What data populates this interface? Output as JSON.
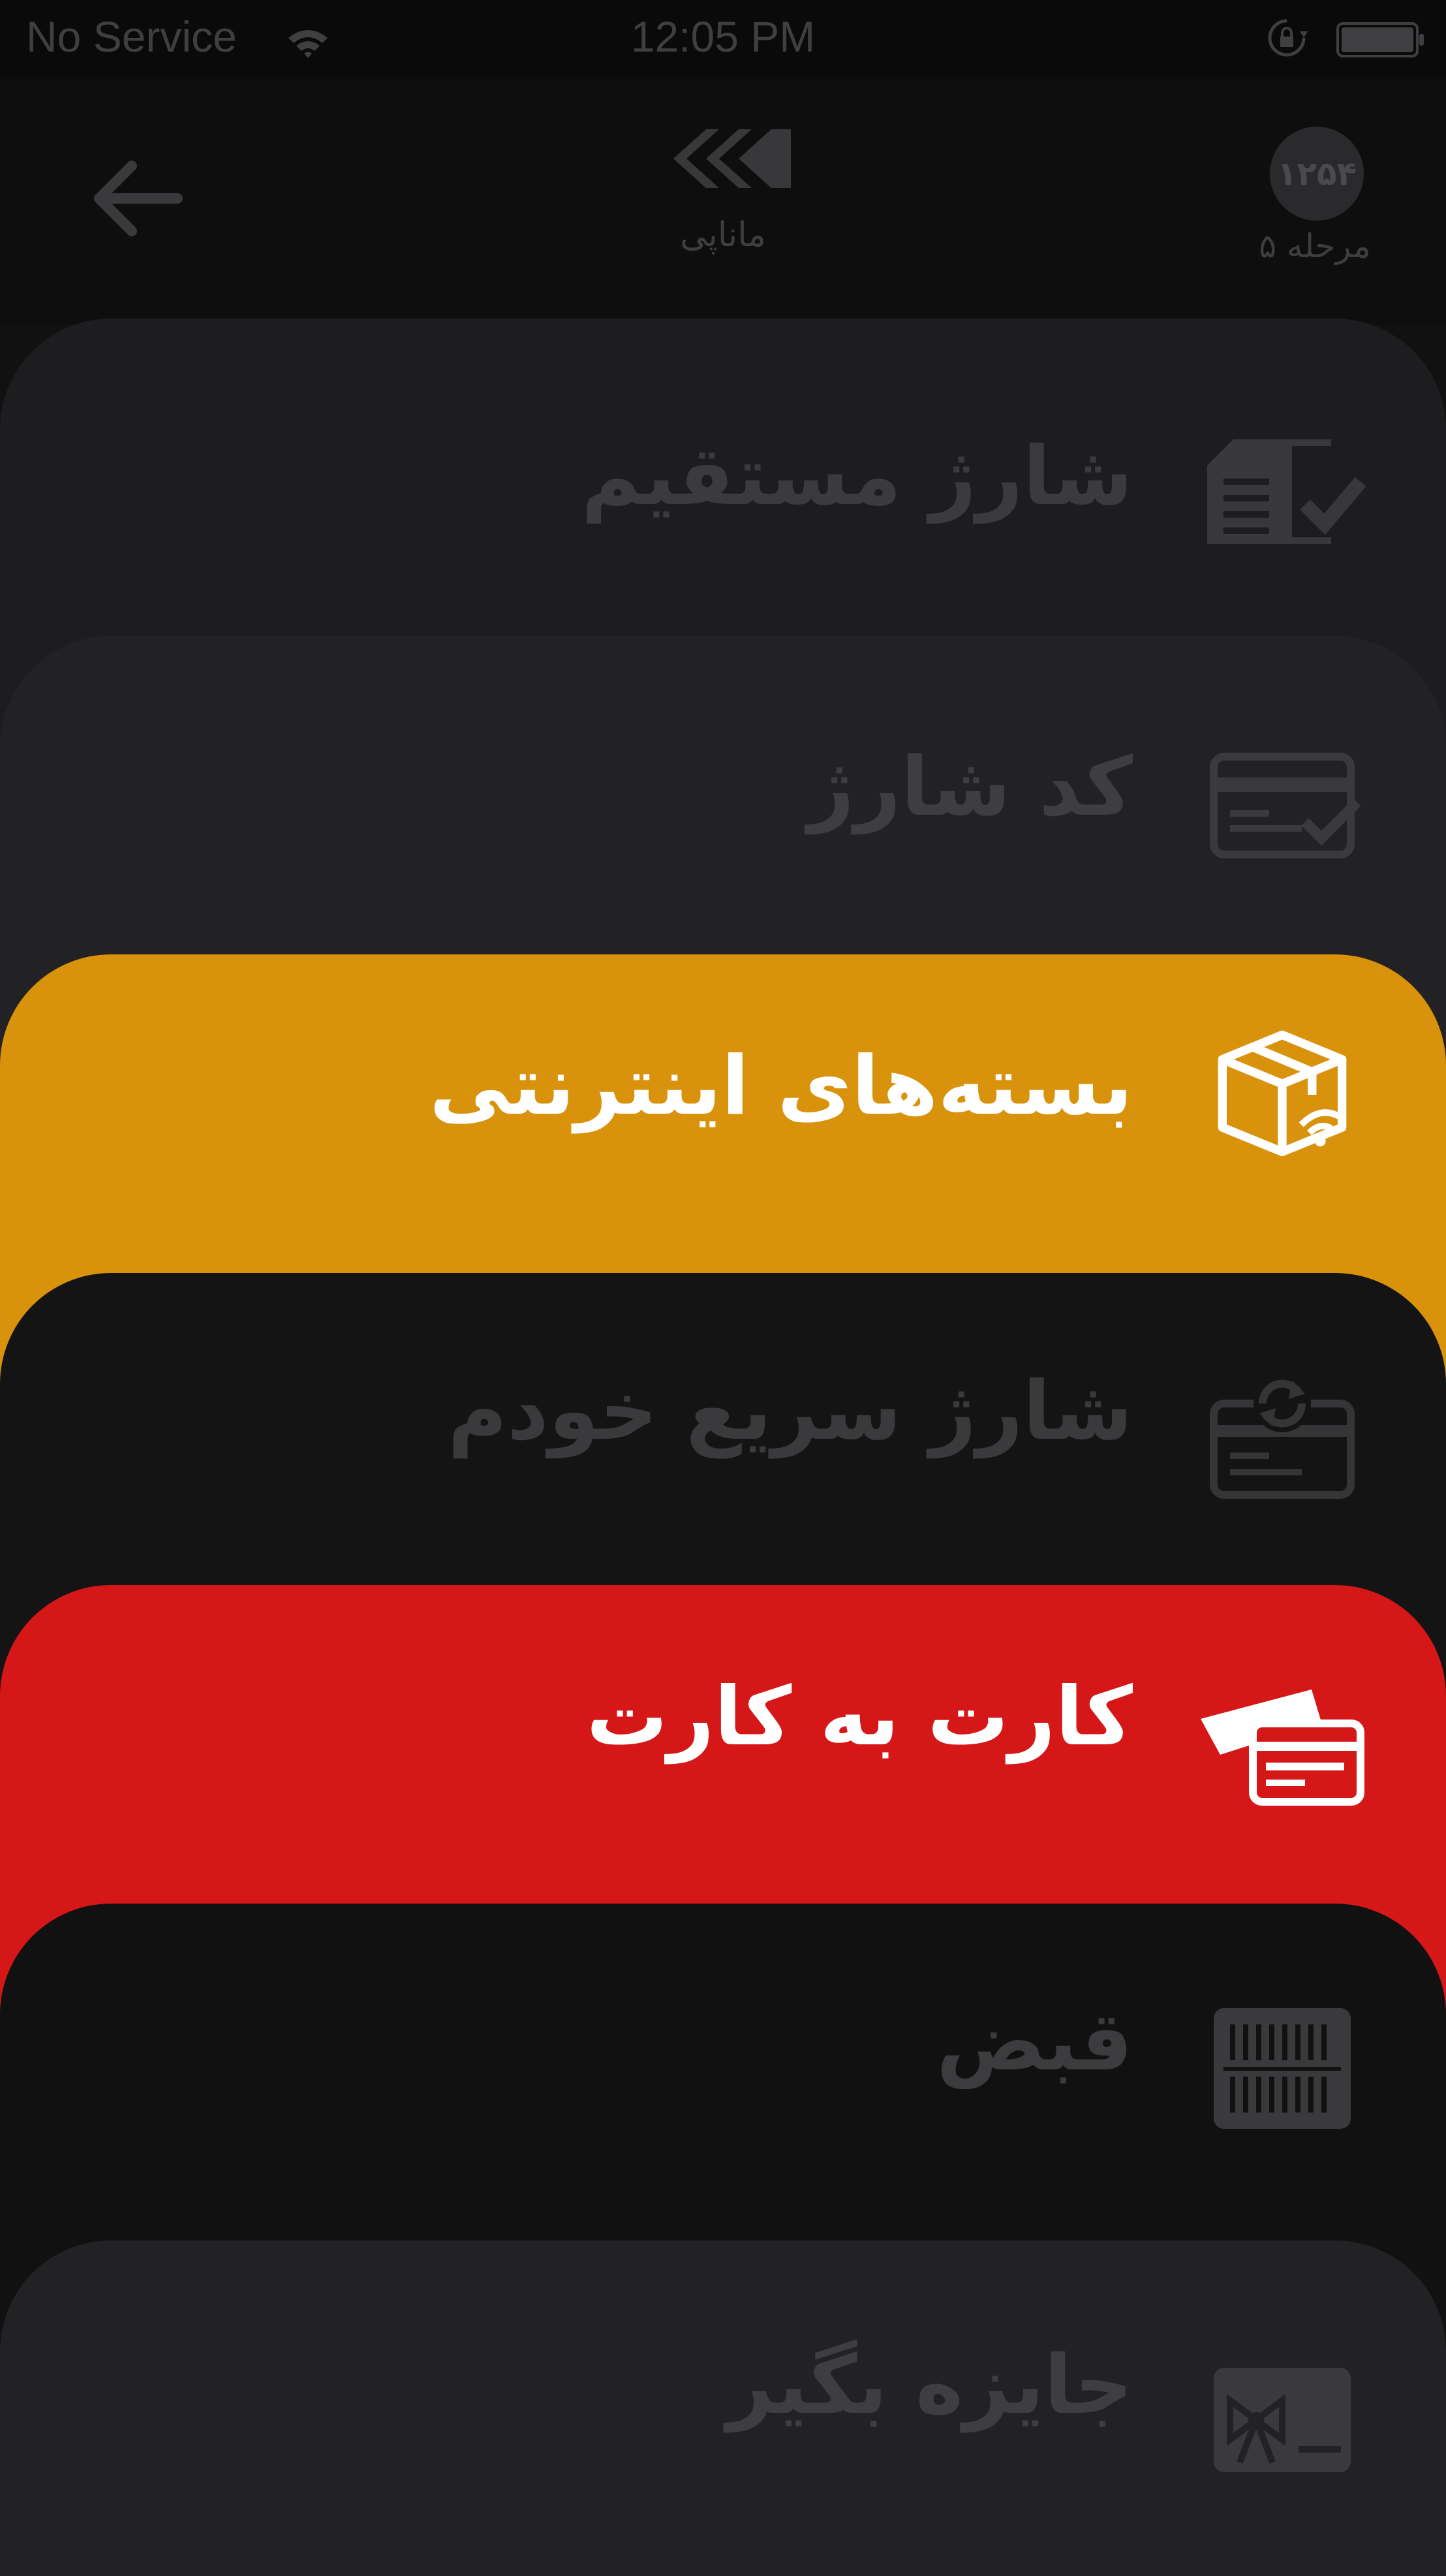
{
  "status_bar": {
    "carrier": "No Service",
    "time": "12:05 PM",
    "wifi_icon": "wifi-icon",
    "lock_icon": "rotation-lock-icon",
    "battery_icon": "battery-icon"
  },
  "header": {
    "back_icon": "arrow-left-icon",
    "logo_icon": "chevrons-logo-icon",
    "logo_text": "ماناپی",
    "level_badge": "۱۲۵۴",
    "level_text": "مرحله ۵"
  },
  "menu": {
    "items": [
      {
        "label": "شارژ مستقیم",
        "icon": "sim-check-icon",
        "color": "#1d1d1f"
      },
      {
        "label": "کد شارژ",
        "icon": "card-check-icon",
        "color": "#222224"
      },
      {
        "label": "بسته‌های اینترنتی",
        "icon": "package-wifi-icon",
        "color": "#d9920b"
      },
      {
        "label": "شارژ سریع خودم",
        "icon": "card-refresh-icon",
        "color": "#141415"
      },
      {
        "label": "کارت به کارت",
        "icon": "card-transfer-icon",
        "color": "#d51718"
      },
      {
        "label": "قبض",
        "icon": "barcode-icon",
        "color": "#111112"
      },
      {
        "label": "جایزه بگیر",
        "icon": "gift-card-icon",
        "color": "#222224"
      }
    ]
  }
}
